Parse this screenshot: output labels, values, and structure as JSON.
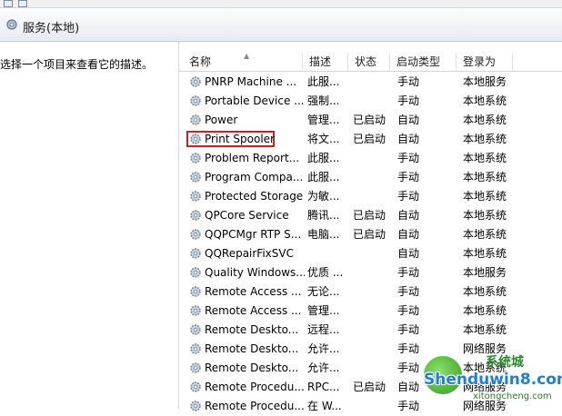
{
  "panel": {
    "title": "服务(本地)"
  },
  "left": {
    "description_hint": "选择一个项目来查看它的描述。"
  },
  "columns": {
    "name": "名称",
    "description": "描述",
    "status": "状态",
    "startup_type": "启动类型",
    "logon_as": "登录为"
  },
  "services": [
    {
      "name": "PNRP Machine ...",
      "description": "此服...",
      "status": "",
      "startup_type": "手动",
      "logon_as": "本地服务"
    },
    {
      "name": "Portable Device ...",
      "description": "强制...",
      "status": "",
      "startup_type": "手动",
      "logon_as": "本地系统"
    },
    {
      "name": "Power",
      "description": "管理...",
      "status": "已启动",
      "startup_type": "自动",
      "logon_as": "本地系统"
    },
    {
      "name": "Print Spooler",
      "description": "将文...",
      "status": "已启动",
      "startup_type": "自动",
      "logon_as": "本地系统",
      "highlighted": true
    },
    {
      "name": "Problem Report...",
      "description": "此服...",
      "status": "",
      "startup_type": "手动",
      "logon_as": "本地系统"
    },
    {
      "name": "Program Compa...",
      "description": "此服...",
      "status": "",
      "startup_type": "手动",
      "logon_as": "本地系统"
    },
    {
      "name": "Protected Storage",
      "description": "为敏...",
      "status": "",
      "startup_type": "手动",
      "logon_as": "本地系统"
    },
    {
      "name": "QPCore Service",
      "description": "腾讯...",
      "status": "已启动",
      "startup_type": "自动",
      "logon_as": "本地系统"
    },
    {
      "name": "QQPCMgr RTP S...",
      "description": "电脑...",
      "status": "已启动",
      "startup_type": "自动",
      "logon_as": "本地系统"
    },
    {
      "name": "QQRepairFixSVC",
      "description": "",
      "status": "",
      "startup_type": "自动",
      "logon_as": "本地系统"
    },
    {
      "name": "Quality Windows...",
      "description": "优质 ...",
      "status": "",
      "startup_type": "手动",
      "logon_as": "本地服务"
    },
    {
      "name": "Remote Access ...",
      "description": "无论...",
      "status": "",
      "startup_type": "手动",
      "logon_as": "本地系统"
    },
    {
      "name": "Remote Access ...",
      "description": "管理...",
      "status": "",
      "startup_type": "手动",
      "logon_as": "本地系统"
    },
    {
      "name": "Remote Deskto...",
      "description": "远程...",
      "status": "",
      "startup_type": "手动",
      "logon_as": "本地系统"
    },
    {
      "name": "Remote Deskto...",
      "description": "允许...",
      "status": "",
      "startup_type": "手动",
      "logon_as": "网络服务"
    },
    {
      "name": "Remote Deskto...",
      "description": "允许...",
      "status": "",
      "startup_type": "手动",
      "logon_as": "本地系统"
    },
    {
      "name": "Remote Procedu...",
      "description": "RPC...",
      "status": "已启动",
      "startup_type": "自动",
      "logon_as": "网络服务"
    },
    {
      "name": "Remote Procedu...",
      "description": "在 W...",
      "status": "",
      "startup_type": "手动",
      "logon_as": "网络服务"
    }
  ],
  "watermark": {
    "brand": "Shenduwin8.com",
    "site": "xitongcheng.com",
    "top_text": "系统城"
  },
  "colors": {
    "highlight_border": "#d21d1d",
    "header_gradient_bottom": "#e6eaf1"
  },
  "icons": {
    "service": "gear-icon",
    "panel": "services-gear-icon"
  }
}
